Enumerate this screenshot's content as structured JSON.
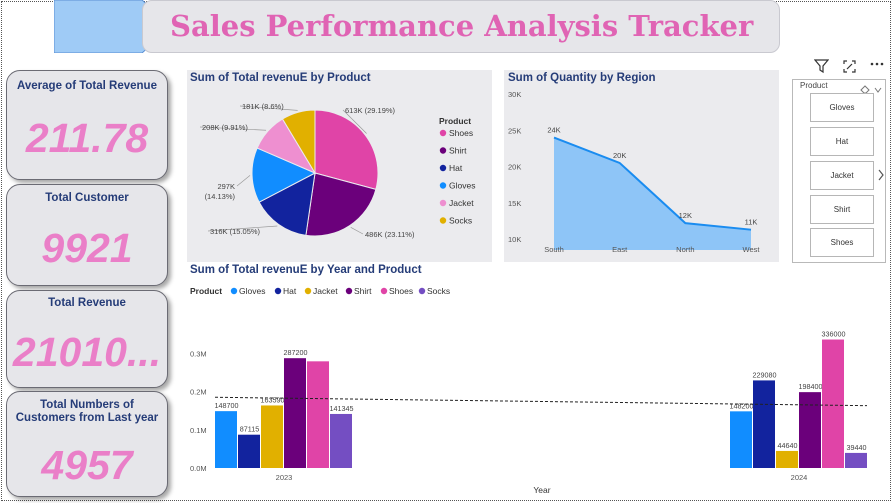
{
  "header": {
    "title": "Sales Performance Analysis Tracker"
  },
  "kpis": [
    {
      "label": "Average of Total Revenue",
      "value": "211.78"
    },
    {
      "label": "Total Customer",
      "value": "9921"
    },
    {
      "label": "Total Revenue",
      "value": "21010..."
    },
    {
      "label": "Total Numbers of Customers from Last year",
      "value": "4957"
    }
  ],
  "colors": {
    "title": "#e064b4",
    "kpi_value": "#ea7fc8",
    "label_navy": "#253c78",
    "Gloves": "#118dff",
    "Hat": "#12239e",
    "Jacket": "#e1b000",
    "Shirt": "#6b007b",
    "Shoes": "#e044a7",
    "Socks": "#744ec2",
    "area": "#8ec5f7",
    "area_line": "#1a8cf0",
    "pie_Gloves": "#118dff",
    "pie_Hat": "#12239e",
    "pie_Jacket": "#ee8fd0",
    "pie_Shirt": "#6b007b",
    "pie_Shoes": "#e044a7",
    "pie_Socks": "#e1b000"
  },
  "toolbar": {
    "filter_icon": "filter-icon",
    "focus_icon": "focus-mode-icon",
    "more_icon": "more-options-icon"
  },
  "slicer": {
    "title": "Product",
    "items": [
      "Gloves",
      "Hat",
      "Jacket",
      "Shirt",
      "Shoes"
    ]
  },
  "chart_data": [
    {
      "type": "pie",
      "title": "Sum of Total revenuE by Product",
      "legend_title": "Product",
      "legend_position": "right",
      "slices": [
        {
          "name": "Shoes",
          "value": 613,
          "label": "613K (29.19%)"
        },
        {
          "name": "Shirt",
          "value": 486,
          "label": "486K (23.11%)"
        },
        {
          "name": "Hat",
          "value": 316,
          "label": "316K (15.05%)"
        },
        {
          "name": "Gloves",
          "value": 297,
          "label_line1": "297K",
          "label_line2": "(14.13%)"
        },
        {
          "name": "Jacket",
          "value": 208,
          "label": "208K (9.91%)"
        },
        {
          "name": "Socks",
          "value": 181,
          "label": "181K (8.6%)"
        }
      ],
      "legend": [
        "Shoes",
        "Shirt",
        "Hat",
        "Gloves",
        "Jacket",
        "Socks"
      ]
    },
    {
      "type": "area",
      "title": "Sum of Quantity by Region",
      "categories": [
        "South",
        "East",
        "North",
        "West"
      ],
      "values": [
        24000,
        20500,
        12200,
        11300
      ],
      "data_labels": [
        "24K",
        "20K",
        "12K",
        "11K"
      ],
      "yticks": [
        "30K",
        "25K",
        "20K",
        "15K",
        "10K"
      ],
      "ylim": [
        8500,
        30000
      ]
    },
    {
      "type": "bar",
      "title": "Sum of Total revenuE by Year and Product",
      "legend_title": "Product",
      "legend_position": "top-left",
      "xlabel": "Year",
      "categories": [
        "2023",
        "2024"
      ],
      "series": [
        {
          "name": "Gloves",
          "values": [
            148700,
            148200
          ],
          "labels": [
            "148700",
            "148200"
          ]
        },
        {
          "name": "Hat",
          "values": [
            87115,
            229080
          ],
          "labels": [
            "87115",
            "229080"
          ]
        },
        {
          "name": "Jacket",
          "values": [
            163590,
            44640
          ],
          "labels": [
            "163590",
            "44640"
          ]
        },
        {
          "name": "Shirt",
          "values": [
            287200,
            198400
          ],
          "labels": [
            "287200",
            "198400"
          ]
        },
        {
          "name": "Shoes",
          "values": [
            279000,
            336000
          ],
          "labels": [
            "",
            "336000"
          ]
        },
        {
          "name": "Socks",
          "values": [
            141345,
            39440
          ],
          "labels": [
            "141345",
            "39440"
          ]
        }
      ],
      "yticks": [
        "0.0M",
        "0.1M",
        "0.2M",
        "0.3M"
      ],
      "ylim": [
        0,
        340000
      ],
      "trend_line": true
    }
  ]
}
